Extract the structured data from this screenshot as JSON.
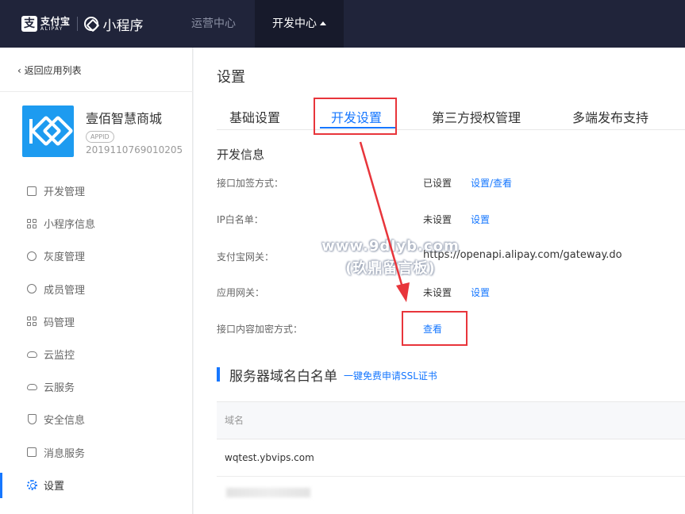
{
  "topbar": {
    "alipay_cn": "支付宝",
    "alipay_en": "ALIPAY",
    "product_title": "小程序",
    "nav_ops": "运营中心",
    "nav_dev": "开发中心"
  },
  "sidebar": {
    "back_label": "返回应用列表",
    "app_name": "壹佰智慧商城",
    "appid_badge": "APPID",
    "appid": "2019110769010205",
    "items": [
      {
        "label": "开发管理",
        "icon": "code-icon"
      },
      {
        "label": "小程序信息",
        "icon": "grid-icon"
      },
      {
        "label": "灰度管理",
        "icon": "broadcast-icon"
      },
      {
        "label": "成员管理",
        "icon": "user-icon"
      },
      {
        "label": "码管理",
        "icon": "qrcode-icon"
      },
      {
        "label": "云监控",
        "icon": "cloud-icon"
      },
      {
        "label": "云服务",
        "icon": "cloud-icon"
      },
      {
        "label": "安全信息",
        "icon": "shield-icon"
      },
      {
        "label": "消息服务",
        "icon": "chart-icon"
      },
      {
        "label": "设置",
        "icon": "gear-icon",
        "active": true
      }
    ]
  },
  "main": {
    "page_title": "设置",
    "tabs": [
      {
        "label": "基础设置"
      },
      {
        "label": "开发设置",
        "active": true
      },
      {
        "label": "第三方授权管理"
      },
      {
        "label": "多端发布支持"
      }
    ],
    "dev_info": {
      "title": "开发信息",
      "rows": [
        {
          "label": "接口加签方式：",
          "value": "已设置",
          "link": "设置/查看"
        },
        {
          "label": "IP白名单：",
          "value": "未设置",
          "link": "设置"
        },
        {
          "label": "支付宝网关：",
          "value": "https://openapi.alipay.com/gateway.do"
        },
        {
          "label": "应用网关：",
          "value": "未设置",
          "link": "设置"
        },
        {
          "label": "接口内容加密方式：",
          "link": "查看"
        }
      ]
    },
    "watermark": {
      "line1": "www.9dlyb.com",
      "line2": "(玖鼎留言板)"
    },
    "server_whitelist": {
      "title": "服务器域名白名单",
      "ssl_link": "一键免费申请SSL证书",
      "column_header": "域名",
      "rows": [
        "wqtest.ybvips.com"
      ]
    }
  },
  "colors": {
    "topbar_bg": "#20243a",
    "accent": "#1677ff",
    "highlight_red": "#e8353b"
  }
}
